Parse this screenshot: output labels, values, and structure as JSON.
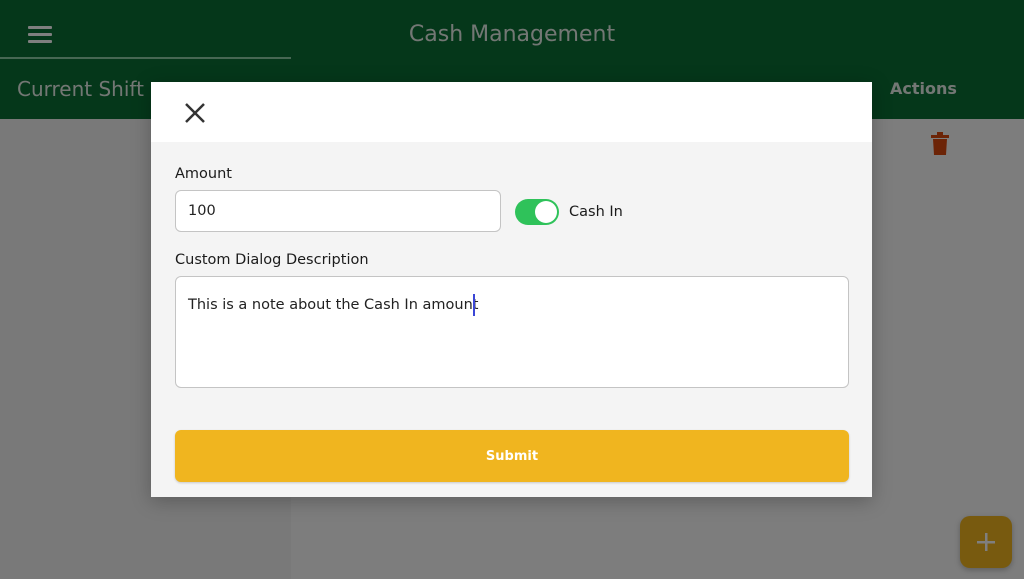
{
  "app": {
    "title": "Cash Management",
    "menu_icon": "hamburger-menu-icon"
  },
  "tabs": {
    "current_shift": "Current Shift",
    "actions_header": "Actions"
  },
  "list": {
    "delete_icon": "trash-icon"
  },
  "fab": {
    "icon": "plus-icon"
  },
  "dialog": {
    "close_icon": "close-icon",
    "amount_label": "Amount",
    "amount_value": "100",
    "toggle_label": "Cash In",
    "toggle_on": true,
    "description_label": "Custom Dialog Description",
    "description_value": "This is a note about the Cash In amount",
    "submit_label": "Submit"
  },
  "colors": {
    "header_green": "#0b6f34",
    "accent_yellow": "#f0b51f",
    "toggle_green": "#2fc25a",
    "trash_orange": "#d9480f"
  }
}
